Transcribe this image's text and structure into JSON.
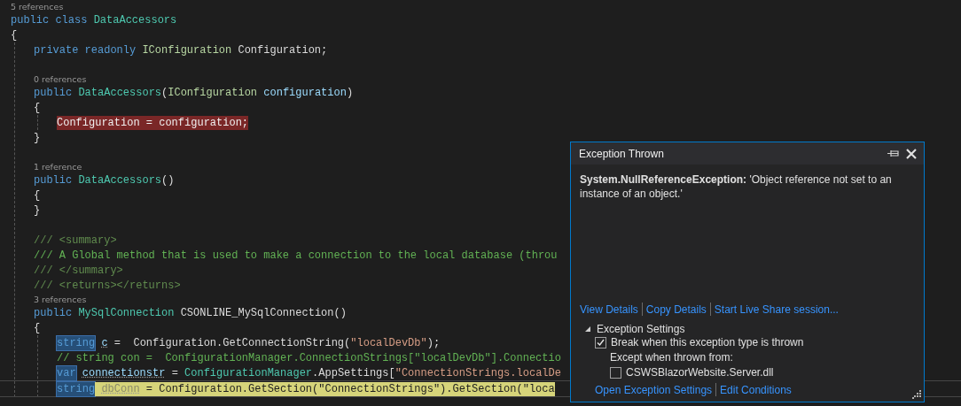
{
  "editor": {
    "lines": [
      {
        "kind": "ref",
        "text": "5 references"
      },
      {
        "kind": "code",
        "tokens": [
          {
            "text": "public class ",
            "kind": "kw"
          },
          {
            "text": "DataAccessors",
            "kind": "type"
          }
        ]
      },
      {
        "kind": "code",
        "tokens": [
          {
            "text": "{",
            "kind": "plain"
          }
        ],
        "children": [
          {
            "kind": "code",
            "tokens": [
              {
                "text": "private readonly ",
                "kind": "kw"
              },
              {
                "text": "IConfiguration",
                "kind": "iface"
              },
              {
                "text": " Configuration;",
                "kind": "plain"
              }
            ]
          },
          {
            "kind": "blank"
          },
          {
            "kind": "ref",
            "text": "0 references"
          },
          {
            "kind": "code",
            "tokens": [
              {
                "text": "public ",
                "kind": "kw"
              },
              {
                "text": "DataAccessors",
                "kind": "type"
              },
              {
                "text": "(",
                "kind": "plain"
              },
              {
                "text": "IConfiguration",
                "kind": "iface"
              },
              {
                "text": " configuration",
                "kind": "param"
              },
              {
                "text": ")",
                "kind": "plain"
              }
            ]
          },
          {
            "kind": "code",
            "tokens": [
              {
                "text": "{",
                "kind": "plain"
              }
            ],
            "children": [
              {
                "kind": "code",
                "tokens": [
                  {
                    "text": "Configuration = configuration;",
                    "kind": "plain",
                    "error": true
                  }
                ]
              }
            ]
          },
          {
            "kind": "code",
            "tokens": [
              {
                "text": "}",
                "kind": "plain"
              }
            ]
          },
          {
            "kind": "blank"
          },
          {
            "kind": "ref",
            "text": "1 reference"
          },
          {
            "kind": "code",
            "tokens": [
              {
                "text": "public ",
                "kind": "kw"
              },
              {
                "text": "DataAccessors",
                "kind": "type"
              },
              {
                "text": "()",
                "kind": "plain"
              }
            ]
          },
          {
            "kind": "code",
            "tokens": [
              {
                "text": "{",
                "kind": "plain"
              }
            ]
          },
          {
            "kind": "code",
            "tokens": [
              {
                "text": "}",
                "kind": "plain"
              }
            ]
          },
          {
            "kind": "blank"
          },
          {
            "kind": "code",
            "tokens": [
              {
                "text": "/// <summary>",
                "kind": "doc"
              }
            ]
          },
          {
            "kind": "code",
            "tokens": [
              {
                "text": "/// A Global method that is used to make a connection to the local database (throu",
                "kind": "comment"
              }
            ]
          },
          {
            "kind": "code",
            "tokens": [
              {
                "text": "/// </summary>",
                "kind": "doc"
              }
            ]
          },
          {
            "kind": "code",
            "tokens": [
              {
                "text": "/// <returns></returns>",
                "kind": "doc"
              }
            ]
          },
          {
            "kind": "ref",
            "text": "3 references"
          },
          {
            "kind": "code",
            "tokens": [
              {
                "text": "public ",
                "kind": "kw"
              },
              {
                "text": "MySqlConnection",
                "kind": "type"
              },
              {
                "text": " CSONLINE_MySqlConnection()",
                "kind": "plain"
              }
            ]
          },
          {
            "kind": "code",
            "tokens": [
              {
                "text": "{",
                "kind": "plain"
              }
            ],
            "children": [
              {
                "kind": "code",
                "tokens": [
                  {
                    "text": "string",
                    "kind": "kw",
                    "reference": true
                  },
                  {
                    "text": " c",
                    "kind": "param",
                    "suggestion": true
                  },
                  {
                    "text": " =  Configuration.GetConnectionString(",
                    "kind": "plain"
                  },
                  {
                    "text": "\"localDevDb\"",
                    "kind": "str"
                  },
                  {
                    "text": ");",
                    "kind": "plain"
                  }
                ]
              },
              {
                "kind": "code",
                "tokens": [
                  {
                    "text": "// string con =  ConfigurationManager.ConnectionStrings[\"localDevDb\"].Connectio",
                    "kind": "comment"
                  }
                ]
              },
              {
                "kind": "code",
                "tokens": [
                  {
                    "text": "var",
                    "kind": "kw",
                    "reference": true
                  },
                  {
                    "text": " connectionstr",
                    "kind": "param",
                    "suggestion": true
                  },
                  {
                    "text": " = ",
                    "kind": "plain"
                  },
                  {
                    "text": "ConfigurationManager",
                    "kind": "type"
                  },
                  {
                    "text": ".AppSettings[",
                    "kind": "plain"
                  },
                  {
                    "text": "\"ConnectionStrings.localDe",
                    "kind": "str"
                  }
                ]
              },
              {
                "kind": "code",
                "current": true,
                "tokens": [
                  {
                    "text": "string",
                    "kind": "kw",
                    "reference": true
                  },
                  {
                    "text": " dbConn",
                    "kind": "unused",
                    "suggestion": true,
                    "current_statement": true
                  },
                  {
                    "text": " = Configuration.GetSection(\"ConnectionStrings\").GetSection(\"loca",
                    "kind": "plain",
                    "current_statement": true
                  }
                ]
              }
            ]
          }
        ]
      }
    ]
  },
  "exception_popup": {
    "title": "Exception Thrown",
    "message": "**System.NullReferenceException:** 'Object reference not set to an instance of an object.'",
    "links": [
      "View Details",
      "Copy Details",
      "Start Live Share session..."
    ],
    "settings": {
      "title": "Exception Settings",
      "expanded": true,
      "break_option": {
        "label": "Break when this exception type is thrown",
        "checked": true
      },
      "except_label": "Except when thrown from:",
      "modules": [
        {
          "label": "CSWSBlazorWebsite.Server.dll",
          "checked": false
        }
      ],
      "links": [
        "Open Exception Settings",
        "Edit Conditions"
      ]
    }
  }
}
